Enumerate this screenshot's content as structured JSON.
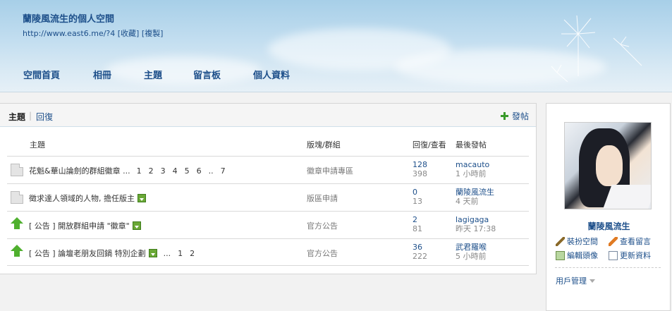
{
  "header": {
    "site_title": "蘭陵風流生的個人空間",
    "url_text": "http://www.east6.me/?4",
    "bookmark_label": "[收藏]",
    "copy_label": "[複製]",
    "nav": [
      "空間首頁",
      "相冊",
      "主題",
      "留言板",
      "個人資料"
    ]
  },
  "main": {
    "tabs": {
      "topics": "主題",
      "separator": "|",
      "replies": "回復"
    },
    "post_new": "發帖",
    "columns": {
      "topic": "主題",
      "forum": "版塊/群組",
      "replies_views": "回復/查看",
      "last_post": "最後發帖"
    },
    "rows": [
      {
        "icon": "document-icon",
        "title": "花魁&華山論劍的群組徽章 ...",
        "has_image": false,
        "pages": [
          "1",
          "2",
          "3",
          "4",
          "5",
          "6",
          "..",
          "7"
        ],
        "forum": "徽章申請專區",
        "replies": "128",
        "views": "398",
        "last_user": "macauto",
        "last_time": "1 小時前"
      },
      {
        "icon": "document-icon",
        "title": "徵求達人領域的人物, 擔任版主",
        "has_image": true,
        "pages": [],
        "forum": "版區申請",
        "replies": "0",
        "views": "13",
        "last_user": "蘭陵風流生",
        "last_time": "4 天前"
      },
      {
        "icon": "pinned-arrow-icon",
        "title": "[ 公告 ] 開放群組申請 \"徽章\"",
        "has_image": true,
        "pages": [],
        "forum": "官方公告",
        "replies": "2",
        "views": "81",
        "last_user": "lagigaga",
        "last_time": "昨天 17:38"
      },
      {
        "icon": "pinned-arrow-icon",
        "title": "[ 公告 ] 論壇老朋友回鍋 特別企劃",
        "has_image": true,
        "pages": [
          "...",
          "1",
          "2"
        ],
        "forum": "官方公告",
        "replies": "36",
        "views": "222",
        "last_user": "武君羅喉",
        "last_time": "5 小時前"
      }
    ]
  },
  "sidebar": {
    "username": "蘭陵風流生",
    "links": {
      "decorate": "裝扮空間",
      "view_messages": "查看留言",
      "edit_avatar": "編輯頭像",
      "update_profile": "更新資料"
    },
    "user_manage": "用戶管理"
  },
  "colors": {
    "link": "#1d4f8a",
    "accent_green": "#4fb02e"
  }
}
